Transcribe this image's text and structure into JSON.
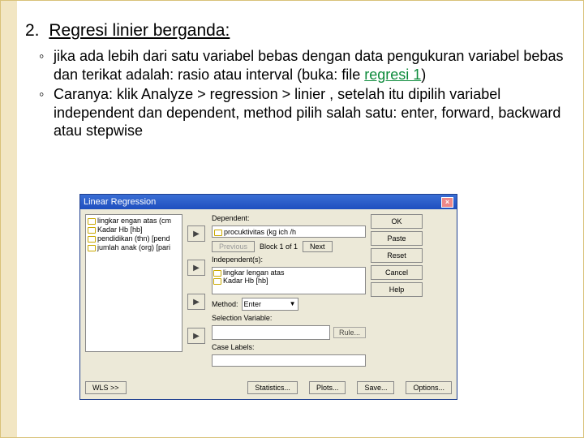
{
  "heading": {
    "number": "2.",
    "title": "Regresi linier berganda:"
  },
  "bullets": {
    "b1a": "jika ada lebih dari satu variabel bebas dengan data pengukuran variabel bebas dan terikat adalah: rasio atau interval (buka: file ",
    "b1link": "regresi 1",
    "b1b": ")",
    "b2": "Caranya: klik Analyze > regression > linier , setelah itu dipilih variabel independent dan dependent, method pilih salah satu: enter, forward, backward atau stepwise"
  },
  "dialog": {
    "title": "Linear Regression",
    "vars": [
      "lingkar engan atas (cm",
      "Kadar Hb  [hb]",
      "pendidikan (thn) [pend",
      "jumlah anak (org) [pari"
    ],
    "dep_label": "Dependent:",
    "dep_value": "procuktivitas (kg ich /h",
    "block_prev": "Previous",
    "block_text": "Block 1 of 1",
    "block_next": "Next",
    "ind_label": "Independent(s):",
    "ind_items": [
      "lingkar lengan atas",
      "Kadar Hb  [hb]"
    ],
    "method_label": "Method:",
    "method_value": "Enter",
    "selvar_label": "Selection Variable:",
    "rule": "Rule...",
    "case_label": "Case Labels:",
    "right": {
      "ok": "OK",
      "paste": "Paste",
      "reset": "Reset",
      "cancel": "Cancel",
      "help": "Help"
    },
    "bottom": {
      "wls": "WLS >>",
      "stats": "Statistics...",
      "plots": "Plots...",
      "save": "Save...",
      "options": "Options..."
    }
  }
}
